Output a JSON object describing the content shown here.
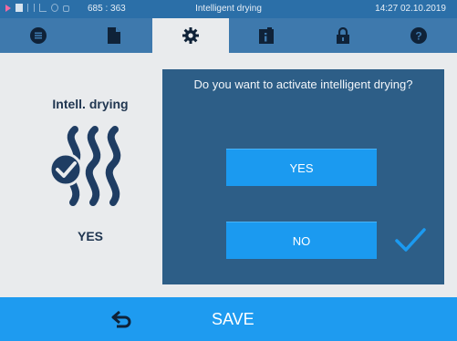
{
  "status": {
    "counter": "685 : 363",
    "title": "Intelligent drying",
    "datetime": "14:27  02.10.2019"
  },
  "tabs": [
    {
      "icon": "list-icon"
    },
    {
      "icon": "document-icon"
    },
    {
      "icon": "gear-icon",
      "active": true
    },
    {
      "icon": "info-icon"
    },
    {
      "icon": "lock-icon"
    },
    {
      "icon": "help-icon"
    }
  ],
  "left_panel": {
    "title": "Intell. drying",
    "value": "YES",
    "icon": "intelligent-drying-icon"
  },
  "dialog": {
    "question": "Do you want to activate intelligent drying?",
    "yes_label": "YES",
    "no_label": "NO",
    "selected": "NO"
  },
  "footer": {
    "save_label": "SAVE",
    "back_icon": "back-arrow-icon"
  },
  "colors": {
    "statusbar": "#2b6fa8",
    "tabbar": "#3e79ad",
    "dialog": "#2d5e87",
    "button": "#1b9af0",
    "footer": "#1e9bf0",
    "text_dark": "#1f3550"
  }
}
